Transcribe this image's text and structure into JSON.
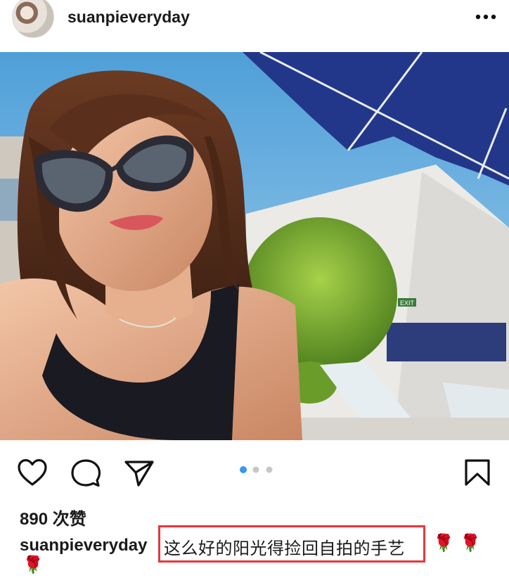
{
  "post": {
    "username": "suanpieveryday",
    "likes": "890 次赞",
    "caption_user": "suanpieveryday",
    "caption_text": "这么好的阳光得捡回自拍的手艺",
    "caption_emojis": [
      "🌹",
      "🌹",
      "🌹"
    ],
    "carousel": {
      "count": 3,
      "active_index": 0
    }
  },
  "photo": {
    "sign_text": "EXIT"
  },
  "colors": {
    "accent_dot": "#3897f0",
    "highlight_border": "#e8373b"
  }
}
